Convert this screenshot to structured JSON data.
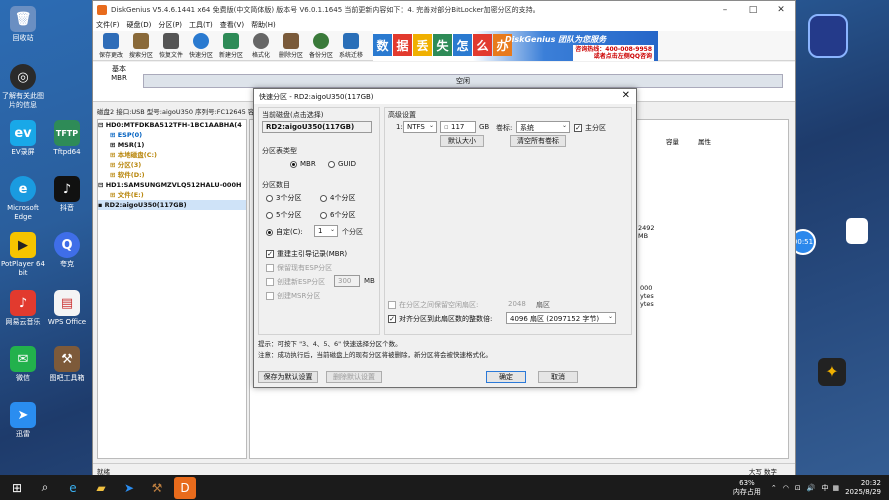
{
  "desktop": {
    "icons": [
      {
        "label": "回收站",
        "name": "recycle-bin"
      },
      {
        "label": "了解有关此图片的信息",
        "name": "learn-about-picture"
      },
      {
        "label": "EV录屏",
        "name": "ev-recorder"
      },
      {
        "label": "Tftpd64",
        "name": "tftpd64"
      },
      {
        "label": "Microsoft Edge",
        "name": "edge"
      },
      {
        "label": "抖音",
        "name": "douyin"
      },
      {
        "label": "PotPlayer 64 bit",
        "name": "potplayer"
      },
      {
        "label": "夸克",
        "name": "quark"
      },
      {
        "label": "网易云音乐",
        "name": "netease-music"
      },
      {
        "label": "WPS Office",
        "name": "wps"
      },
      {
        "label": "微信",
        "name": "wechat"
      },
      {
        "label": "图吧工具箱",
        "name": "tuba-toolbox"
      },
      {
        "label": "迅雷",
        "name": "xunlei"
      }
    ],
    "float_label": "00:51"
  },
  "window": {
    "title": "DiskGenius V5.4.6.1441 x64 免费版(中文简体版)    版本号 V6.0.1.1645  当前更新内容如下：4. 完善对部分BitLocker加密分区的支持。",
    "menu": [
      "文件(F)",
      "硬盘(D)",
      "分区(P)",
      "工具(T)",
      "查看(V)",
      "帮助(H)"
    ],
    "toolbar": [
      "保存更改",
      "搜索分区",
      "恢复文件",
      "快速分区",
      "新建分区",
      "格式化",
      "删除分区",
      "备份分区",
      "系统迁移"
    ],
    "banner": {
      "chars": [
        "数",
        "据",
        "丢",
        "失",
        "怎",
        "么",
        "办"
      ],
      "slogan": "DiskGenius 团队为您服务",
      "phone": "咨询热线：400-008-9958",
      "phone2": "或者点击左侧QQ咨询"
    },
    "disk_label": "基本\nMBR",
    "free_label": "空闲",
    "disk_info": "磁盘2 接口:USB  型号:aigoU350  序列号:FC12645  容量:117.2GB(120000MB)  柱面数:15298  磁头数:255  每道扇区数:63  总扇区数:245760000",
    "tree": [
      "HD0:MTFDKBA512TFH-1BC1AABHA(4",
      "ESP(0)",
      "MSR(1)",
      "本地磁盘(C:)",
      "分区(3)",
      "软件(D:)",
      "HD1:SAMSUNGMZVLQ512HALU-000H",
      "文件(E:)",
      "RD2:aigoU350(117GB)"
    ],
    "right_cols": [
      "容量",
      "属性"
    ],
    "right_nums": [
      "2492",
      "MB",
      "000",
      "ytes",
      "ytes"
    ],
    "status": "就绪",
    "status_right": "大写  数字"
  },
  "dialog": {
    "title": "快速分区 - RD2:aigoU350(117GB)",
    "current_disk_label": "当前磁盘(点击选择)",
    "current_disk": "RD2:aigoU350(117GB)",
    "partition_type_label": "分区表类型",
    "mbr": "MBR",
    "guid": "GUID",
    "partition_count_label": "分区数目",
    "counts": [
      "3个分区",
      "4个分区",
      "5个分区",
      "6个分区"
    ],
    "custom": "自定(C):",
    "custom_value": "1",
    "custom_unit": "个分区",
    "rebuild_mbr": "重建主引导记录(MBR)",
    "keep_esp": "保留现有ESP分区",
    "create_esp": "创建新ESP分区",
    "esp_size": "300",
    "esp_unit": "MB",
    "create_msr": "创建MSR分区",
    "advanced_label": "高级设置",
    "row_index": "1:",
    "fs": "NTFS",
    "size": "117",
    "size_unit": "GB",
    "volume_label": "卷标:",
    "volume_value": "系统",
    "primary": "主分区",
    "default_size_btn": "默认大小",
    "clear_labels_btn": "清空所有卷标",
    "align_cyl": "在分区之间保留空闲扇区:",
    "align_cyl_value": "2048",
    "align_cyl_unit": "扇区",
    "align_sector": "对齐分区到此扇区数的整数倍:",
    "align_sector_value": "4096 扇区 (2097152 字节)",
    "hint1": "提示：可按下 \"3、4、5、6\" 快速选择分区个数。",
    "hint2": "注意：成功执行后，当前磁盘上的现有分区将被删除，新分区将会被快速格式化。",
    "save_default_btn": "保存为默认设置",
    "delete_default_btn": "删除默认设置",
    "ok_btn": "确定",
    "cancel_btn": "取消"
  },
  "taskbar": {
    "battery": "63%",
    "battery_label": "内存占用",
    "ime": "中",
    "time": "20:32",
    "date": "2025/8/29"
  }
}
